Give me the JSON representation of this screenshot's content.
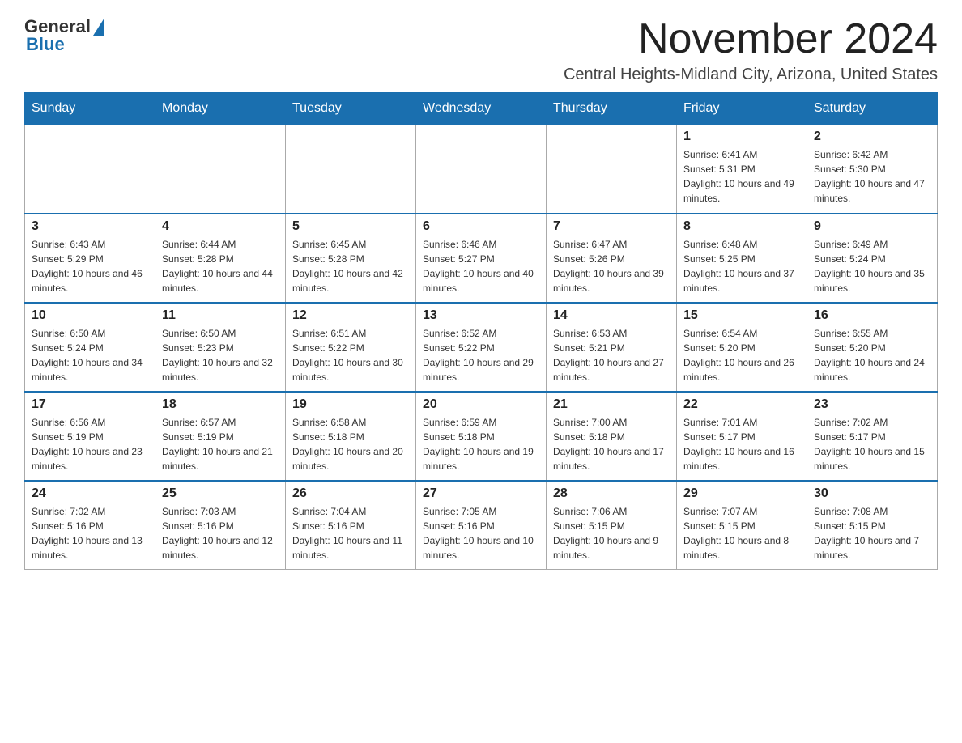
{
  "logo": {
    "general": "General",
    "blue": "Blue"
  },
  "title": "November 2024",
  "location": "Central Heights-Midland City, Arizona, United States",
  "days_of_week": [
    "Sunday",
    "Monday",
    "Tuesday",
    "Wednesday",
    "Thursday",
    "Friday",
    "Saturday"
  ],
  "weeks": [
    [
      {
        "day": "",
        "sunrise": "",
        "sunset": "",
        "daylight": ""
      },
      {
        "day": "",
        "sunrise": "",
        "sunset": "",
        "daylight": ""
      },
      {
        "day": "",
        "sunrise": "",
        "sunset": "",
        "daylight": ""
      },
      {
        "day": "",
        "sunrise": "",
        "sunset": "",
        "daylight": ""
      },
      {
        "day": "",
        "sunrise": "",
        "sunset": "",
        "daylight": ""
      },
      {
        "day": "1",
        "sunrise": "Sunrise: 6:41 AM",
        "sunset": "Sunset: 5:31 PM",
        "daylight": "Daylight: 10 hours and 49 minutes."
      },
      {
        "day": "2",
        "sunrise": "Sunrise: 6:42 AM",
        "sunset": "Sunset: 5:30 PM",
        "daylight": "Daylight: 10 hours and 47 minutes."
      }
    ],
    [
      {
        "day": "3",
        "sunrise": "Sunrise: 6:43 AM",
        "sunset": "Sunset: 5:29 PM",
        "daylight": "Daylight: 10 hours and 46 minutes."
      },
      {
        "day": "4",
        "sunrise": "Sunrise: 6:44 AM",
        "sunset": "Sunset: 5:28 PM",
        "daylight": "Daylight: 10 hours and 44 minutes."
      },
      {
        "day": "5",
        "sunrise": "Sunrise: 6:45 AM",
        "sunset": "Sunset: 5:28 PM",
        "daylight": "Daylight: 10 hours and 42 minutes."
      },
      {
        "day": "6",
        "sunrise": "Sunrise: 6:46 AM",
        "sunset": "Sunset: 5:27 PM",
        "daylight": "Daylight: 10 hours and 40 minutes."
      },
      {
        "day": "7",
        "sunrise": "Sunrise: 6:47 AM",
        "sunset": "Sunset: 5:26 PM",
        "daylight": "Daylight: 10 hours and 39 minutes."
      },
      {
        "day": "8",
        "sunrise": "Sunrise: 6:48 AM",
        "sunset": "Sunset: 5:25 PM",
        "daylight": "Daylight: 10 hours and 37 minutes."
      },
      {
        "day": "9",
        "sunrise": "Sunrise: 6:49 AM",
        "sunset": "Sunset: 5:24 PM",
        "daylight": "Daylight: 10 hours and 35 minutes."
      }
    ],
    [
      {
        "day": "10",
        "sunrise": "Sunrise: 6:50 AM",
        "sunset": "Sunset: 5:24 PM",
        "daylight": "Daylight: 10 hours and 34 minutes."
      },
      {
        "day": "11",
        "sunrise": "Sunrise: 6:50 AM",
        "sunset": "Sunset: 5:23 PM",
        "daylight": "Daylight: 10 hours and 32 minutes."
      },
      {
        "day": "12",
        "sunrise": "Sunrise: 6:51 AM",
        "sunset": "Sunset: 5:22 PM",
        "daylight": "Daylight: 10 hours and 30 minutes."
      },
      {
        "day": "13",
        "sunrise": "Sunrise: 6:52 AM",
        "sunset": "Sunset: 5:22 PM",
        "daylight": "Daylight: 10 hours and 29 minutes."
      },
      {
        "day": "14",
        "sunrise": "Sunrise: 6:53 AM",
        "sunset": "Sunset: 5:21 PM",
        "daylight": "Daylight: 10 hours and 27 minutes."
      },
      {
        "day": "15",
        "sunrise": "Sunrise: 6:54 AM",
        "sunset": "Sunset: 5:20 PM",
        "daylight": "Daylight: 10 hours and 26 minutes."
      },
      {
        "day": "16",
        "sunrise": "Sunrise: 6:55 AM",
        "sunset": "Sunset: 5:20 PM",
        "daylight": "Daylight: 10 hours and 24 minutes."
      }
    ],
    [
      {
        "day": "17",
        "sunrise": "Sunrise: 6:56 AM",
        "sunset": "Sunset: 5:19 PM",
        "daylight": "Daylight: 10 hours and 23 minutes."
      },
      {
        "day": "18",
        "sunrise": "Sunrise: 6:57 AM",
        "sunset": "Sunset: 5:19 PM",
        "daylight": "Daylight: 10 hours and 21 minutes."
      },
      {
        "day": "19",
        "sunrise": "Sunrise: 6:58 AM",
        "sunset": "Sunset: 5:18 PM",
        "daylight": "Daylight: 10 hours and 20 minutes."
      },
      {
        "day": "20",
        "sunrise": "Sunrise: 6:59 AM",
        "sunset": "Sunset: 5:18 PM",
        "daylight": "Daylight: 10 hours and 19 minutes."
      },
      {
        "day": "21",
        "sunrise": "Sunrise: 7:00 AM",
        "sunset": "Sunset: 5:18 PM",
        "daylight": "Daylight: 10 hours and 17 minutes."
      },
      {
        "day": "22",
        "sunrise": "Sunrise: 7:01 AM",
        "sunset": "Sunset: 5:17 PM",
        "daylight": "Daylight: 10 hours and 16 minutes."
      },
      {
        "day": "23",
        "sunrise": "Sunrise: 7:02 AM",
        "sunset": "Sunset: 5:17 PM",
        "daylight": "Daylight: 10 hours and 15 minutes."
      }
    ],
    [
      {
        "day": "24",
        "sunrise": "Sunrise: 7:02 AM",
        "sunset": "Sunset: 5:16 PM",
        "daylight": "Daylight: 10 hours and 13 minutes."
      },
      {
        "day": "25",
        "sunrise": "Sunrise: 7:03 AM",
        "sunset": "Sunset: 5:16 PM",
        "daylight": "Daylight: 10 hours and 12 minutes."
      },
      {
        "day": "26",
        "sunrise": "Sunrise: 7:04 AM",
        "sunset": "Sunset: 5:16 PM",
        "daylight": "Daylight: 10 hours and 11 minutes."
      },
      {
        "day": "27",
        "sunrise": "Sunrise: 7:05 AM",
        "sunset": "Sunset: 5:16 PM",
        "daylight": "Daylight: 10 hours and 10 minutes."
      },
      {
        "day": "28",
        "sunrise": "Sunrise: 7:06 AM",
        "sunset": "Sunset: 5:15 PM",
        "daylight": "Daylight: 10 hours and 9 minutes."
      },
      {
        "day": "29",
        "sunrise": "Sunrise: 7:07 AM",
        "sunset": "Sunset: 5:15 PM",
        "daylight": "Daylight: 10 hours and 8 minutes."
      },
      {
        "day": "30",
        "sunrise": "Sunrise: 7:08 AM",
        "sunset": "Sunset: 5:15 PM",
        "daylight": "Daylight: 10 hours and 7 minutes."
      }
    ]
  ]
}
